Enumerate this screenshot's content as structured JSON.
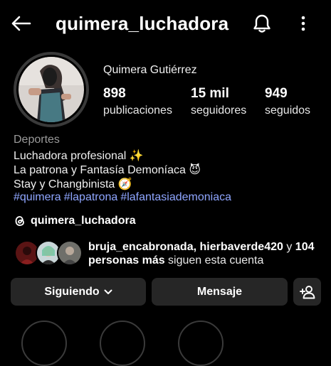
{
  "header": {
    "handle": "quimera_luchadora",
    "back_icon": "arrow-left-icon",
    "bell_icon": "bell-icon",
    "more_icon": "more-vertical-icon"
  },
  "profile": {
    "full_name": "Quimera Gutiérrez",
    "stats": [
      {
        "value": "898",
        "label": "publicaciones"
      },
      {
        "value": "15 mil",
        "label": "seguidores"
      },
      {
        "value": "949",
        "label": "seguidos"
      }
    ]
  },
  "bio": {
    "category": "Deportes",
    "lines": [
      "Luchadora profesional ✨",
      "La patrona y Fantasía Demoníaca  😈",
      "Stay y Changbinista 🧭"
    ],
    "hashtags": [
      "#quimera",
      "#lapatrona",
      "#lafantasiademoniaca"
    ],
    "threads_handle": "quimera_luchadora"
  },
  "followed_by": {
    "names": "bruja_encabronada, hierbaverde420",
    "connector": " y ",
    "others": "104 personas más",
    "suffix": " siguen esta cuenta"
  },
  "actions": {
    "following_label": "Siguiendo",
    "message_label": "Mensaje"
  },
  "colors": {
    "background": "#000000",
    "button": "#262626",
    "hashtag": "#8fa6ff",
    "category": "#9b9b9b"
  }
}
